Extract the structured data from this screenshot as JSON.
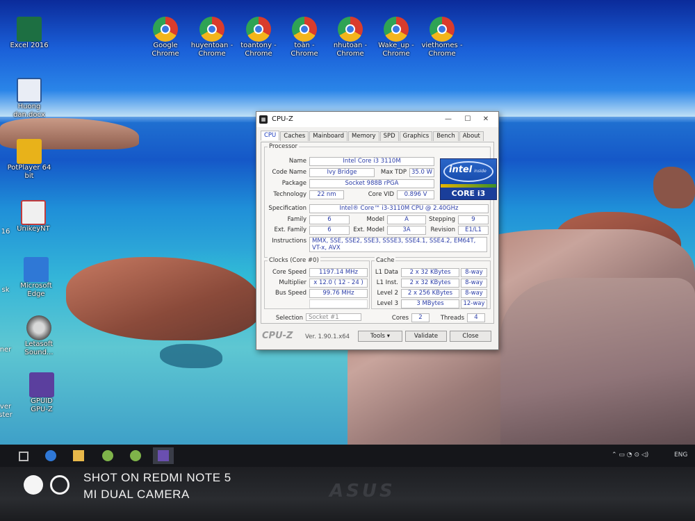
{
  "desktop": {
    "icons_top": [
      {
        "label_line1": "Google",
        "label_line2": "Chrome"
      },
      {
        "label_line1": "huyentoan -",
        "label_line2": "Chrome"
      },
      {
        "label_line1": "toantony -",
        "label_line2": "Chrome"
      },
      {
        "label_line1": "toàn -",
        "label_line2": "Chrome"
      },
      {
        "label_line1": "nhutoan -",
        "label_line2": "Chrome"
      },
      {
        "label_line1": "Wake_up -",
        "label_line2": "Chrome"
      },
      {
        "label_line1": "viethomes -",
        "label_line2": "Chrome"
      }
    ],
    "icons_left": [
      {
        "label_line1": "Excel 2016",
        "label_line2": ""
      },
      {
        "label_line1": "Huong",
        "label_line2": "dan.docx"
      },
      {
        "label_line1": "PotPlayer 64",
        "label_line2": "bit"
      },
      {
        "label_line1": "UnikeyNT",
        "label_line2": ""
      },
      {
        "label_line1": "Microsoft",
        "label_line2": "Edge"
      },
      {
        "label_line1": "Letasoft",
        "label_line2": "Sound..."
      },
      {
        "label_line1": "GPUID",
        "label_line2": "GPU-Z"
      }
    ],
    "icons_edge": [
      {
        "label": "16"
      },
      {
        "label": "sk"
      },
      {
        "label": "ner"
      },
      {
        "label": "ver"
      },
      {
        "label": "ster"
      }
    ]
  },
  "cpuz": {
    "title": "CPU-Z",
    "tabs": [
      "CPU",
      "Caches",
      "Mainboard",
      "Memory",
      "SPD",
      "Graphics",
      "Bench",
      "About"
    ],
    "processor": {
      "group_title": "Processor",
      "labels": {
        "name": "Name",
        "code_name": "Code Name",
        "max_tdp": "Max TDP",
        "package": "Package",
        "technology": "Technology",
        "core_vid": "Core VID",
        "specification": "Specification",
        "family": "Family",
        "model": "Model",
        "stepping": "Stepping",
        "ext_family": "Ext. Family",
        "ext_model": "Ext. Model",
        "revision": "Revision",
        "instructions": "Instructions"
      },
      "name": "Intel Core i3 3110M",
      "code_name": "Ivy Bridge",
      "max_tdp": "35.0 W",
      "package": "Socket 988B rPGA",
      "technology": "22 nm",
      "core_vid": "0.896 V",
      "specification": "Intel® Core™ i3-3110M CPU @ 2.40GHz",
      "family": "6",
      "model": "A",
      "stepping": "9",
      "ext_family": "6",
      "ext_model": "3A",
      "revision": "E1/L1",
      "instructions": "MMX, SSE, SSE2, SSE3, SSSE3, SSE4.1, SSE4.2, EM64T, VT-x, AVX"
    },
    "logo": {
      "brand": "intel",
      "inside": "inside",
      "series": "CORE i3"
    },
    "clocks": {
      "group_title": "Clocks (Core #0)",
      "labels": {
        "core_speed": "Core Speed",
        "multiplier": "Multiplier",
        "bus_speed": "Bus Speed"
      },
      "core_speed": "1197.14 MHz",
      "multiplier": "x 12.0 ( 12 - 24 )",
      "bus_speed": "99.76 MHz"
    },
    "cache": {
      "group_title": "Cache",
      "rows": [
        {
          "label": "L1 Data",
          "size": "2 x 32 KBytes",
          "way": "8-way"
        },
        {
          "label": "L1 Inst.",
          "size": "2 x 32 KBytes",
          "way": "8-way"
        },
        {
          "label": "Level 2",
          "size": "2 x 256 KBytes",
          "way": "8-way"
        },
        {
          "label": "Level 3",
          "size": "3 MBytes",
          "way": "12-way"
        }
      ]
    },
    "selection": {
      "label": "Selection",
      "value": "Socket #1",
      "cores_label": "Cores",
      "cores": "2",
      "threads_label": "Threads",
      "threads": "4"
    },
    "footer": {
      "brand": "CPU-Z",
      "version": "Ver. 1.90.1.x64",
      "tools": "Tools",
      "validate": "Validate",
      "close": "Close"
    }
  },
  "tray": {
    "language": "ENG"
  },
  "watermark": {
    "line1": "SHOT ON REDMI NOTE 5",
    "line2": "MI DUAL CAMERA"
  },
  "bezel": {
    "brand": "ASUS"
  },
  "colors": {
    "value_text": "#2b3da8",
    "active_tab": "#1c3cbd",
    "taskbar": "#15161a"
  }
}
